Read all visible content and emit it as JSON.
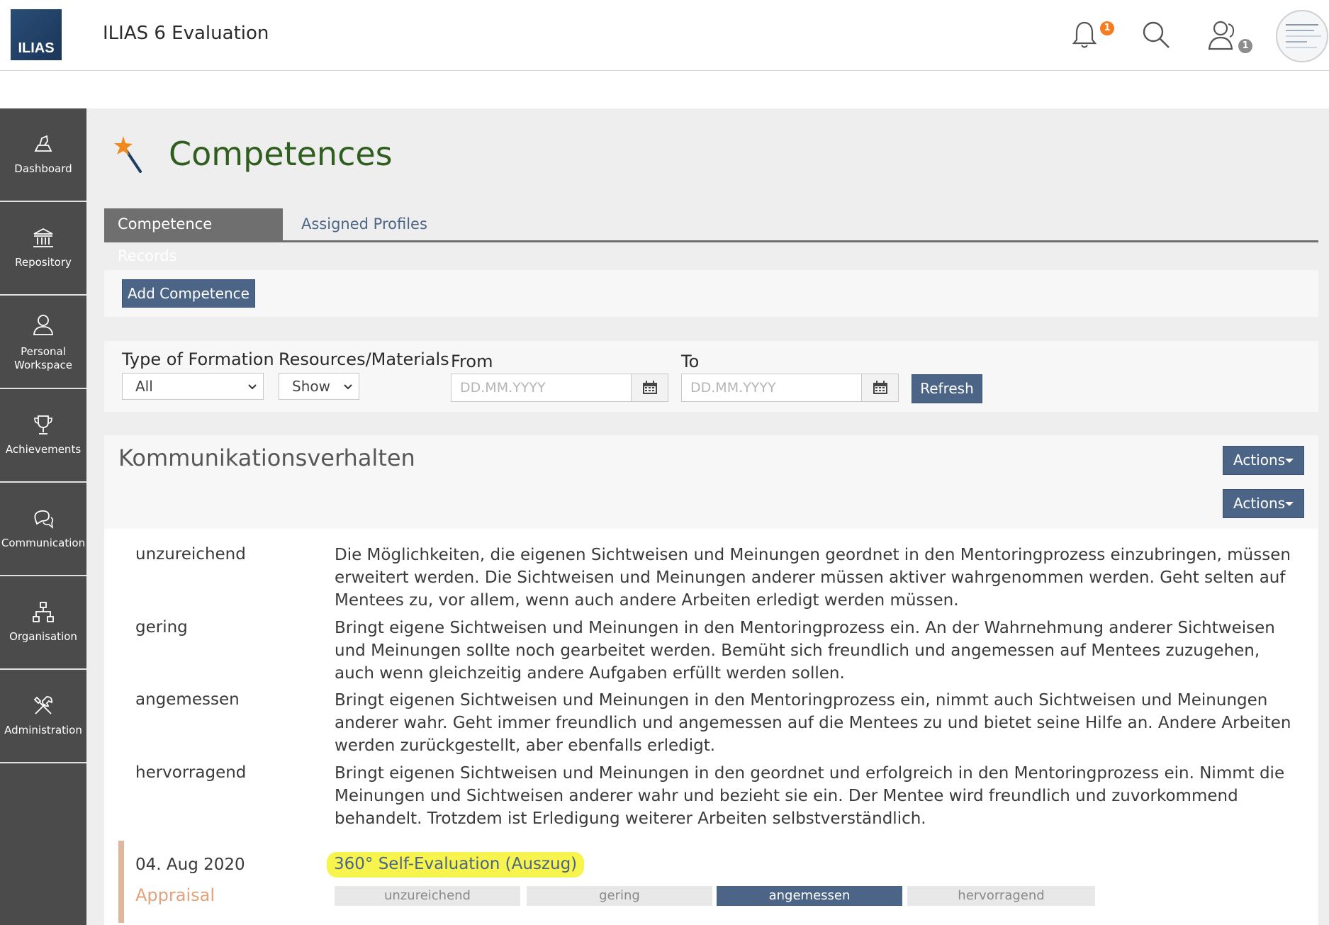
{
  "header": {
    "logo_text": "ILIAS",
    "app_title": "ILIAS 6 Evaluation",
    "notifications_badge": "1",
    "contacts_badge": "1",
    "icons": [
      "bell-icon",
      "search-icon",
      "contacts-icon",
      "avatar"
    ]
  },
  "sidebar": {
    "items": [
      {
        "label": "Dashboard",
        "icon": "dashboard-icon"
      },
      {
        "label": "Repository",
        "icon": "repository-icon"
      },
      {
        "label": "Personal Workspace",
        "icon": "person-icon"
      },
      {
        "label": "Achievements",
        "icon": "trophy-icon"
      },
      {
        "label": "Communication",
        "icon": "chat-icon"
      },
      {
        "label": "Organisation",
        "icon": "org-chart-icon"
      },
      {
        "label": "Administration",
        "icon": "tools-icon"
      }
    ]
  },
  "page": {
    "title": "Competences",
    "title_icon": "magic-wand-icon"
  },
  "tabs": [
    {
      "label": "Competence Records",
      "active": true
    },
    {
      "label": "Assigned Profiles",
      "active": false
    }
  ],
  "toolbar": {
    "add_label": "Add Competence"
  },
  "filters": {
    "type_label": "Type of Formation",
    "type_value": "All",
    "resources_label": "Resources/Materials",
    "resources_value": "Show",
    "from_label": "From",
    "from_placeholder": "DD.MM.YYYY",
    "to_label": "To",
    "to_placeholder": "DD.MM.YYYY",
    "refresh_label": "Refresh"
  },
  "competence": {
    "title": "Kommunikationsverhalten",
    "actions_label": "Actions",
    "levels": [
      {
        "name": "unzureichend",
        "description": "Die Möglichkeiten, die eigenen Sichtweisen und Meinungen geordnet in den Mentoringprozess einzubringen, müssen erweitert werden. Die Sichtweisen und Meinungen anderer müssen aktiver wahrgenommen werden. Geht selten auf Mentees zu, vor allem, wenn auch andere Arbeiten erledigt werden müssen."
      },
      {
        "name": "gering",
        "description": "Bringt eigene Sichtweisen und Meinungen in den Mentoringprozess ein. An der Wahrnehmung anderer Sichtweisen und Meinungen sollte noch gearbeitet werden. Bemüht sich freundlich und angemessen auf Mentees zuzugehen, auch wenn gleichzeitig andere Aufgaben erfüllt werden sollen."
      },
      {
        "name": "angemessen",
        "description": "Bringt eigenen Sichtweisen und Meinungen in den Mentoringprozess ein, nimmt auch Sichtweisen und Meinungen anderer wahr. Geht immer freundlich und angemessen auf die Mentees zu und bietet seine Hilfe an. Andere Arbeiten werden zurückgestellt, aber ebenfalls erledigt."
      },
      {
        "name": "hervorragend",
        "description": "Bringt eigenen Sichtweisen und Meinungen in den geordnet und erfolgreich in den Mentoringprozess ein. Nimmt die Meinungen und Sichtweisen anderer wahr und bezieht sie ein. Der Mentee wird freundlich und zuvorkommend behandelt. Trotzdem ist Erledigung weiterer Arbeiten selbstverständlich."
      }
    ],
    "record": {
      "date": "04. Aug 2020",
      "type": "Appraisal",
      "source": "360° Self-Evaluation (Auszug)",
      "scale": [
        "unzureichend",
        "gering",
        "angemessen",
        "hervorragend"
      ],
      "selected": "angemessen"
    }
  },
  "colors": {
    "accent": "#4c6586",
    "title_green": "#2f5e1f",
    "sidebar": "#4b4b4b",
    "highlight": "#f7f44d",
    "appraisal": "#e2a27a"
  }
}
